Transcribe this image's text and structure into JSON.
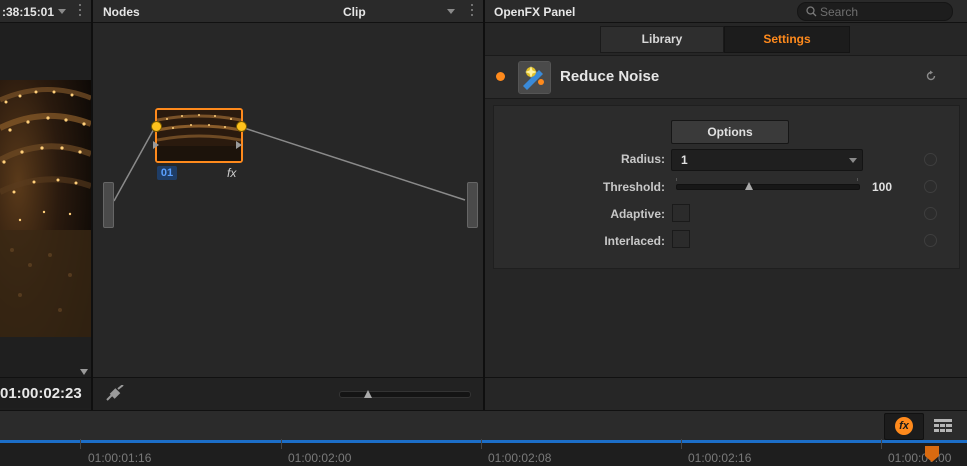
{
  "viewer": {
    "timecode_top": ":38:15:01",
    "timecode_bottom": "01:00:02:23"
  },
  "nodes": {
    "title": "Nodes",
    "mode": "Clip",
    "node": {
      "label": "01",
      "fx_label": "fx"
    }
  },
  "openfx": {
    "title": "OpenFX Panel",
    "search_placeholder": "Search",
    "tabs": [
      "Library",
      "Settings"
    ],
    "active_tab": "Settings",
    "plugin": {
      "name": "Reduce Noise"
    },
    "options_label": "Options",
    "params": {
      "radius_label": "Radius:",
      "radius_value": "1",
      "threshold_label": "Threshold:",
      "threshold_value": "100",
      "adaptive_label": "Adaptive:",
      "interlaced_label": "Interlaced:"
    }
  },
  "timeline": {
    "timecodes": [
      "01:00:01:16",
      "01:00:02:00",
      "01:00:02:08",
      "01:00:02:16",
      "01:00:0?:00"
    ]
  },
  "colors": {
    "accent_orange": "#ff8a1c",
    "node_blue": "#3b7bd8",
    "playhead_blue": "#1c6ec8"
  }
}
